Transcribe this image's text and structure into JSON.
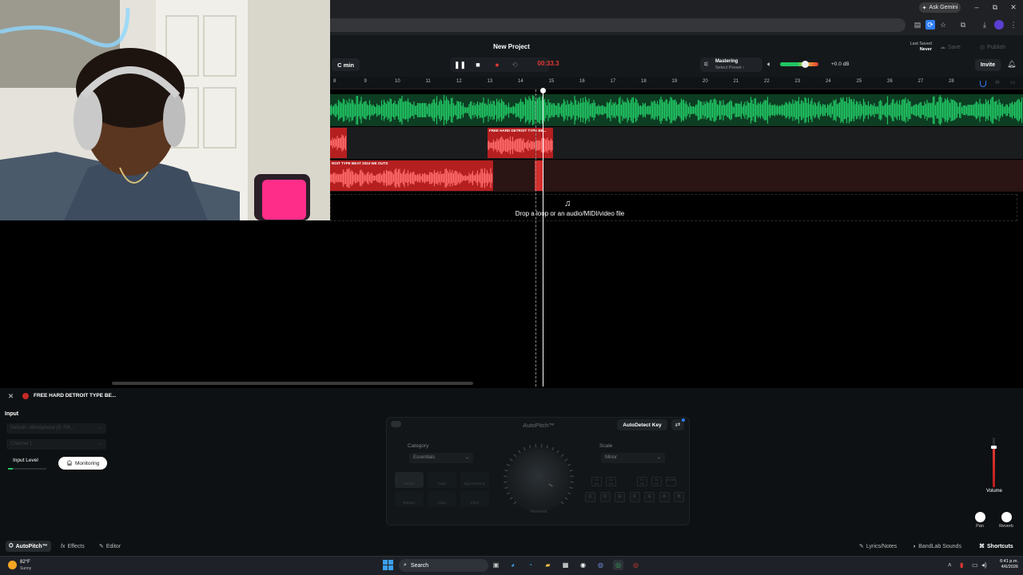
{
  "browser": {
    "ask_gemini": "Ask Gemini",
    "win_minimize": "–",
    "win_restore": "⧉",
    "win_close": "✕"
  },
  "daw": {
    "project_title": "New Project",
    "key": "C min",
    "time": "00:33.3",
    "mastering_title": "Mastering",
    "mastering_sub": "Select Preset ›",
    "volume_db": "+0.0 dB",
    "volume_level": 0.62,
    "last_saved_label": "Last Saved",
    "last_saved_value": "Never",
    "save": "Save",
    "publish": "Publish",
    "invite": "Invite"
  },
  "ruler": [
    "8",
    "9",
    "10",
    "11",
    "12",
    "13",
    "14",
    "15",
    "16",
    "17",
    "18",
    "19",
    "20",
    "21",
    "22",
    "23",
    "24",
    "25",
    "26",
    "27",
    "28"
  ],
  "tracks": {
    "clip2_name": "FREE HARD DETROIT TYPE BE...",
    "clip3_name": "ROIT TYPE BEAT 2024 WE OUTS"
  },
  "drop_zone": "Drop a loop or an audio/MIDI/video file",
  "panel": {
    "title": "FREE HARD DETROIT TYPE BE...",
    "input_label": "Input",
    "input_device": "Default - Microphone (3- Fift...",
    "input_channel": "Channel 1",
    "input_level": "Input Level",
    "monitoring": "Monitoring",
    "ap_title": "AutoPitch™",
    "autodetect": "AutoDetect Key",
    "category_label": "Category",
    "category_value": "Essentials",
    "scale_label": "Scale",
    "scale_value": "Minor",
    "styles": [
      "Classic",
      "Duet",
      "Big Harmony",
      "Robotic",
      "Hard",
      "Choir"
    ],
    "knob_label": "Heaviest",
    "notes_top": [
      "C#\nDb",
      "D#\nEb",
      "F#\nGb",
      "G#\nAb",
      "A#\nBb"
    ],
    "notes": [
      "C",
      "D",
      "E",
      "F",
      "G",
      "A",
      "B"
    ],
    "volume_label": "Volume",
    "volume_fader_level": 0.8,
    "pan_label": "Pan",
    "reverb_label": "Reverb"
  },
  "bottom_tabs": {
    "autopitch": "AutoPitch™",
    "effects": "Effects",
    "editor": "Editor",
    "lyrics": "Lyrics/Notes",
    "sounds": "BandLab Sounds",
    "shortcuts": "Shortcuts"
  },
  "taskbar": {
    "temp": "82°F",
    "condition": "Sunny",
    "search": "Search",
    "time": "6:41 p.m.",
    "date": "4/6/2026"
  },
  "colors": {
    "green_wave": "#21c463",
    "red_clip": "#e53935",
    "accent_blue": "#2f7dfb"
  }
}
